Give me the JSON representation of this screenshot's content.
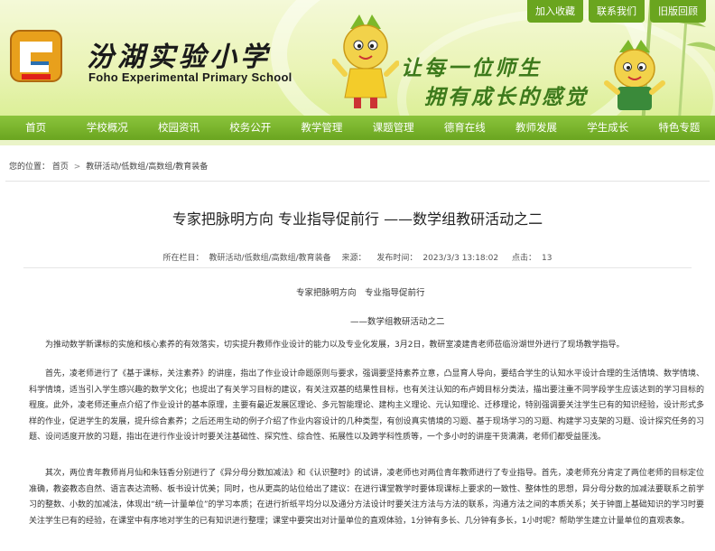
{
  "header": {
    "school_name_cn": "汾湖实验小学",
    "school_name_en": "Foho Experimental Primary School",
    "slogan_line1": "让每一位师生",
    "slogan_line2": "拥有成长的感觉",
    "top_links": [
      "加入收藏",
      "联系我们",
      "旧版回顾"
    ]
  },
  "nav": {
    "items": [
      "首页",
      "学校概况",
      "校园资讯",
      "校务公开",
      "教学管理",
      "课题管理",
      "德育在线",
      "教师发展",
      "学生成长",
      "特色专题"
    ]
  },
  "breadcrumb": {
    "prefix": "您的位置：",
    "items": [
      "首页",
      "教研活动/低数组/高数组/教育装备"
    ]
  },
  "article": {
    "title": "专家把脉明方向 专业指导促前行 ——数学组教研活动之二",
    "meta": {
      "column_label": "所在栏目：",
      "column_value": "教研活动/低数组/高数组/教育装备",
      "source_label": "来源：",
      "time_label": "发布时间：",
      "time_value": "2023/3/3 13:18:02",
      "clicks_label": "点击：",
      "clicks_value": "13"
    },
    "subtitle_line1": "专家把脉明方向　专业指导促前行",
    "subtitle_line2": "——数学组教研活动之二",
    "paragraphs": [
      "为推动数学新课标的实施和核心素养的有效落实，切实提升教师作业设计的能力以及专业化发展，3月2日，教研室凌建青老师莅临汾湖世外进行了现场教学指导。",
      "首先，凌老师进行了《基于课标，关注素养》的讲座，指出了作业设计命题原则与要求，强调要坚持素养立意，凸显育人导向，要结合学生的认知水平设计合理的生活情境、数学情境、科学情境，适当引入学生感兴趣的数学文化；也提出了有关学习目标的建议，有关注双基的结果性目标，也有关注认知的布卢姆目标分类法，描出要注重不同学段学生应该达到的学习目标的程度。此外，凌老师还重点介绍了作业设计的基本原理，主要有最近发展区理论、多元智能理论、建构主义理论、元认知理论、迁移理论，特别强调要关注学生已有的知识经验，设计形式多样的作业，促进学生的发展，提升综合素养；之后还用生动的例子介绍了作业内容设计的几种类型，有创设真实情境的习题、基于现场学习的习题、构建学习支架的习题、设计探究任务的习题、设问适度开放的习题，指出在进行作业设计时要关注基础性、探究性、综合性、拓展性以及跨学科性质等，一个多小时的讲座干货满满，老师们都受益匪浅。",
      "其次，两位青年教师肖月仙和朱钰香分别进行了《异分母分数加减法》和《认识整时》的试讲，凌老师也对两位青年教师进行了专业指导。首先，凌老师充分肯定了两位老师的目标定位准确，教姿教态自然、语言表达流畅、板书设计优美；同时，也从更高的站位给出了建议：在进行课堂教学时要体现课标上要求的一致性、整体性的思想，异分母分数的加减法要联系之前学习的整数、小数的加减法，体现出“统一计量单位”的学习本质；在进行折纸平均分以及通分方法设计时要关注方法与方法的联系，沟通方法之间的本质关系；关于钟面上基础知识的学习时要关注学生已有的经验，在课堂中有序地对学生的已有知识进行整理；课堂中要突出对计量单位的直观体验，1分钟有多长、几分钟有多长，1小时呢？帮助学生建立计量单位的直观表象。"
    ]
  },
  "colors": {
    "nav_green": "#6aa51f",
    "slogan_green": "#3d7a1c",
    "banner_bg": "#eaf4b6"
  }
}
